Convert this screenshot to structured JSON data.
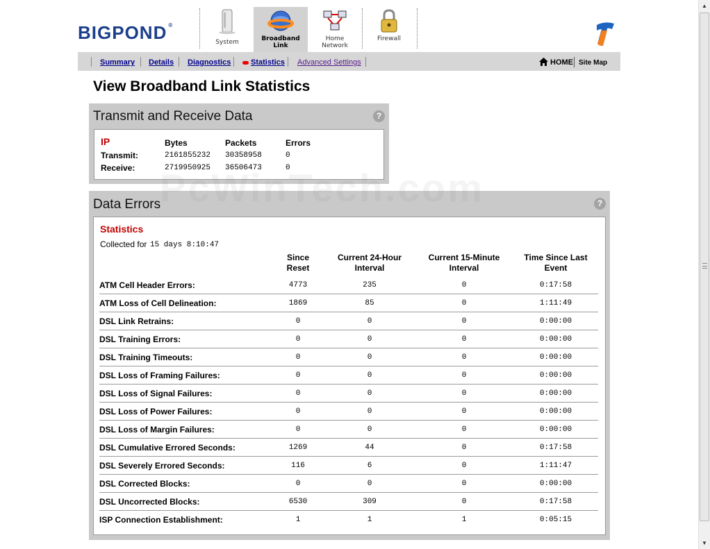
{
  "brand": {
    "logo_text": "BIGPOND",
    "reg_mark": "®",
    "accent": "#1c3f8b"
  },
  "top_tabs": [
    {
      "label1": "System",
      "label2": "",
      "icon": "system-icon"
    },
    {
      "label1": "Broadband",
      "label2": "Link",
      "icon": "broadband-globe-icon",
      "active": true
    },
    {
      "label1": "Home",
      "label2": "Network",
      "icon": "home-network-icon"
    },
    {
      "label1": "Firewall",
      "label2": "",
      "icon": "padlock-icon"
    }
  ],
  "nav": {
    "summary": "Summary",
    "details": "Details",
    "diagnostics": "Diagnostics",
    "statistics": "Statistics",
    "advanced": "Advanced Settings",
    "home": "HOME",
    "sitemap": "Site Map"
  },
  "page_title": "View Broadband Link Statistics",
  "transmit_panel": {
    "title": "Transmit and Receive Data",
    "help": "?",
    "section": "IP",
    "headers": [
      "Bytes",
      "Packets",
      "Errors"
    ],
    "rows": [
      {
        "label": "Transmit:",
        "bytes": "2161855232",
        "packets": "30358958",
        "errors": "0"
      },
      {
        "label": "Receive:",
        "bytes": "2719950925",
        "packets": "36506473",
        "errors": "0"
      }
    ]
  },
  "errors_panel": {
    "title": "Data Errors",
    "help": "?",
    "section": "Statistics",
    "collected_label": "Collected for",
    "collected_value": "15 days 8:10:47",
    "headers": [
      {
        "l1": "Since",
        "l2": "Reset"
      },
      {
        "l1": "Current 24-Hour",
        "l2": "Interval"
      },
      {
        "l1": "Current 15-Minute",
        "l2": "Interval"
      },
      {
        "l1": "Time Since Last",
        "l2": "Event"
      }
    ],
    "rows": [
      {
        "label": "ATM Cell Header Errors:",
        "since": "4773",
        "h24": "235",
        "m15": "0",
        "last": "0:17:58"
      },
      {
        "label": "ATM Loss of Cell Delineation:",
        "since": "1869",
        "h24": "85",
        "m15": "0",
        "last": "1:11:49"
      },
      {
        "label": "DSL Link Retrains:",
        "since": "0",
        "h24": "0",
        "m15": "0",
        "last": "0:00:00"
      },
      {
        "label": "DSL Training Errors:",
        "since": "0",
        "h24": "0",
        "m15": "0",
        "last": "0:00:00"
      },
      {
        "label": "DSL Training Timeouts:",
        "since": "0",
        "h24": "0",
        "m15": "0",
        "last": "0:00:00"
      },
      {
        "label": "DSL Loss of Framing Failures:",
        "since": "0",
        "h24": "0",
        "m15": "0",
        "last": "0:00:00"
      },
      {
        "label": "DSL Loss of Signal Failures:",
        "since": "0",
        "h24": "0",
        "m15": "0",
        "last": "0:00:00"
      },
      {
        "label": "DSL Loss of Power Failures:",
        "since": "0",
        "h24": "0",
        "m15": "0",
        "last": "0:00:00"
      },
      {
        "label": "DSL Loss of Margin Failures:",
        "since": "0",
        "h24": "0",
        "m15": "0",
        "last": "0:00:00"
      },
      {
        "label": "DSL Cumulative Errored Seconds:",
        "since": "1269",
        "h24": "44",
        "m15": "0",
        "last": "0:17:58"
      },
      {
        "label": "DSL Severely Errored Seconds:",
        "since": "116",
        "h24": "6",
        "m15": "0",
        "last": "1:11:47"
      },
      {
        "label": "DSL Corrected Blocks:",
        "since": "0",
        "h24": "0",
        "m15": "0",
        "last": "0:00:00"
      },
      {
        "label": "DSL Uncorrected Blocks:",
        "since": "6530",
        "h24": "309",
        "m15": "0",
        "last": "0:17:58"
      },
      {
        "label": "ISP Connection Establishment:",
        "since": "1",
        "h24": "1",
        "m15": "1",
        "last": "0:05:15"
      }
    ]
  },
  "watermark": "PcWinTech.com"
}
